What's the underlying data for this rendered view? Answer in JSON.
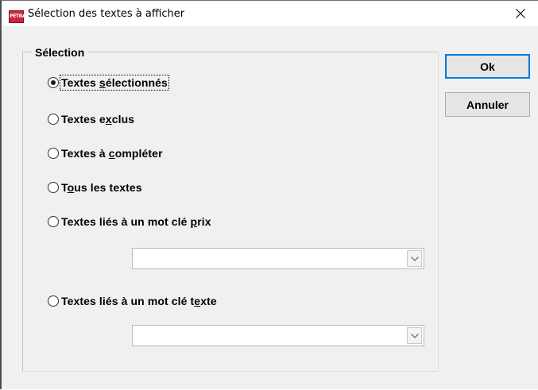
{
  "window": {
    "title": "Sélection des textes à afficher",
    "app_icon_text": "PÉTRA"
  },
  "group": {
    "legend": "Sélection"
  },
  "options": [
    {
      "before": "Textes ",
      "ul": "s",
      "after": "électionnés",
      "checked": true
    },
    {
      "before": "Textes e",
      "ul": "x",
      "after": "clus",
      "checked": false
    },
    {
      "before": "Textes à ",
      "ul": "c",
      "after": "ompléter",
      "checked": false
    },
    {
      "before": "T",
      "ul": "o",
      "after": "us les textes",
      "checked": false
    },
    {
      "before": "Textes liés à un mot clé ",
      "ul": "p",
      "after": "rix",
      "checked": false
    },
    {
      "before": "Textes liés à un mot clé t",
      "ul": "e",
      "after": "xte",
      "checked": false
    }
  ],
  "combos": {
    "prix": {
      "value": ""
    },
    "texte": {
      "value": ""
    }
  },
  "buttons": {
    "ok": "Ok",
    "cancel": "Annuler"
  }
}
